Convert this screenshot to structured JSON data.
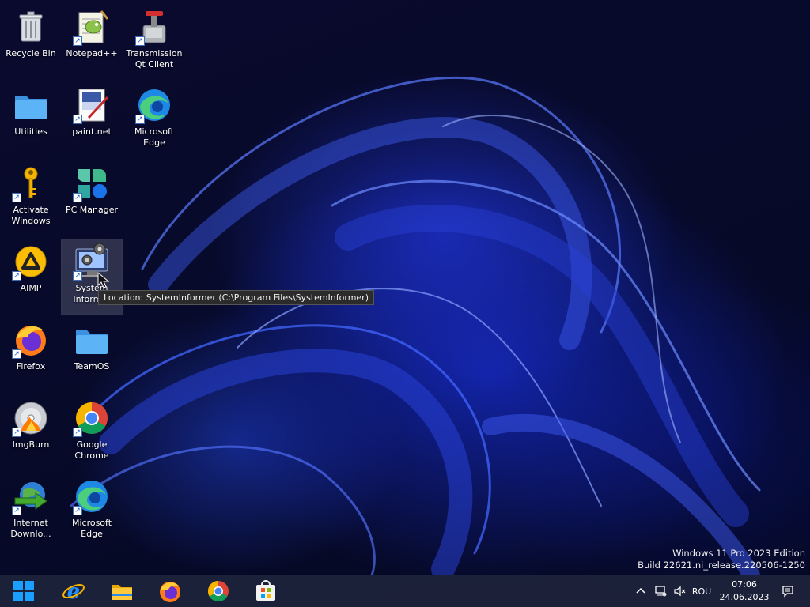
{
  "desktop": {
    "icons": [
      {
        "label": "Recycle Bin",
        "icon": "recycle-bin-icon"
      },
      {
        "label": "Notepad++",
        "icon": "notepad-plus-plus-icon"
      },
      {
        "label": "Transmission Qt Client",
        "icon": "transmission-icon"
      },
      {
        "label": "Utilities",
        "icon": "folder-icon"
      },
      {
        "label": "paint.net",
        "icon": "paint-net-icon"
      },
      {
        "label": "Microsoft Edge",
        "icon": "edge-icon"
      },
      {
        "label": "Activate Windows",
        "icon": "key-icon"
      },
      {
        "label": "PC Manager",
        "icon": "pc-manager-icon"
      },
      {
        "label": "AIMP",
        "icon": "aimp-icon"
      },
      {
        "label": "System Informer",
        "icon": "system-informer-icon"
      },
      {
        "label": "Firefox",
        "icon": "firefox-icon"
      },
      {
        "label": "TeamOS",
        "icon": "folder-icon"
      },
      {
        "label": "ImgBurn",
        "icon": "imgburn-icon"
      },
      {
        "label": "Google Chrome",
        "icon": "chrome-icon"
      },
      {
        "label": "Internet Downlo...",
        "icon": "internet-download-manager-icon"
      },
      {
        "label": "Microsoft Edge",
        "icon": "edge-icon"
      }
    ],
    "tooltip": "Location: SystemInformer (C:\\Program Files\\SystemInformer)",
    "watermark": {
      "line1": "Windows 11 Pro 2023 Edition",
      "line2": "Build 22621.ni_release.220506-1250"
    }
  },
  "taskbar": {
    "pinned": [
      "windows-start-icon",
      "internet-explorer-icon",
      "file-explorer-icon",
      "firefox-icon",
      "chrome-icon",
      "microsoft-store-icon"
    ],
    "tray": {
      "language": "ROU",
      "time": "07:06",
      "date": "24.06.2023"
    }
  },
  "colors": {
    "taskbar": "#1e243c",
    "wallpaper_accent": "#2536d6",
    "folder": "#4aa8f0"
  }
}
